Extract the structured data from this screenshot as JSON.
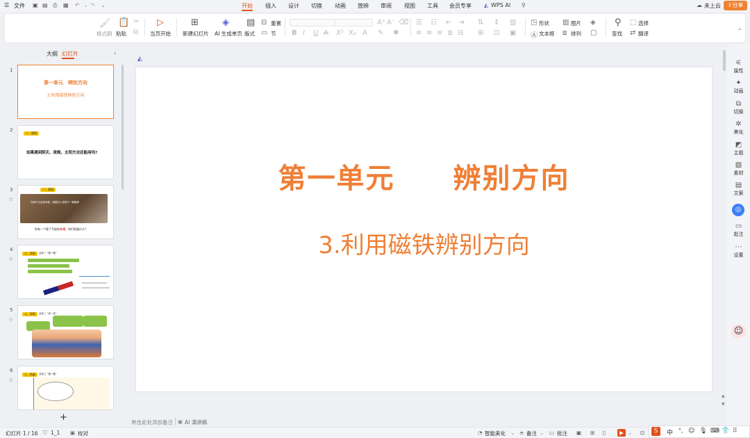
{
  "titlebar": {
    "file_menu": "文件",
    "cloud": "未上云",
    "share": "分享",
    "menus": [
      "开始",
      "插入",
      "设计",
      "切换",
      "动画",
      "放映",
      "审阅",
      "视图",
      "工具",
      "会员专享",
      "WPS AI"
    ]
  },
  "ribbon": {
    "format_painter": "格式刷",
    "paste": "粘贴",
    "from_current": "当页开始",
    "new_slide": "新建幻灯片",
    "ai_single": "AI 生成单页",
    "layout": "版式",
    "section": "节",
    "reset": "重置",
    "shape": "形状",
    "textbox": "文本框",
    "picture": "图片",
    "arrange": "排列",
    "find": "查找",
    "select": "选择",
    "translate": "翻译"
  },
  "left_panel": {
    "tab_outline": "大纲",
    "tab_slides": "幻灯片",
    "slides": [
      {
        "num": "1",
        "title": "第一单元　辨别方向",
        "subtitle": "3.利用磁铁辨别方向"
      },
      {
        "num": "2",
        "tag": "一、情境",
        "text": "如果遇到阴天、夜晚，太阳方法还能用吗?"
      },
      {
        "num": "3",
        "tag": "一、情境",
        "line1": "在两千五百多年前，我国古人发明了一种磁体",
        "line2": "你有一个更了不起的",
        "highlight": "本领",
        "line3": "，你们知道什么?"
      },
      {
        "num": "4",
        "tag": "二、探索",
        "subtitle": "活动一 “做一做”"
      },
      {
        "num": "5",
        "tag": "二、探索",
        "subtitle": "活动二 “说一说”"
      },
      {
        "num": "6",
        "tag": "三、拓展",
        "subtitle": "活动三 “做一做”"
      }
    ]
  },
  "slide": {
    "title": "第一单元　　辨别方向",
    "subtitle": "3.利用磁铁辨别方向"
  },
  "notes": {
    "placeholder": "单击此处添加备注",
    "ai_notes": "AI 演讲稿"
  },
  "right_sidebar": [
    "属性",
    "动画",
    "切换",
    "美化",
    "主题",
    "素材",
    "文案",
    "批注",
    "设置"
  ],
  "statusbar": {
    "slide_count": "幻灯片 1 / 16",
    "theme": "1_1",
    "proofread": "校对",
    "smart_beautify": "智能美化",
    "notes": "备注",
    "comments": "批注",
    "ime_lang": "中"
  },
  "colors": {
    "accent": "#e1501b",
    "title_orange": "#ef7f35",
    "share_bg": "#f08331"
  }
}
